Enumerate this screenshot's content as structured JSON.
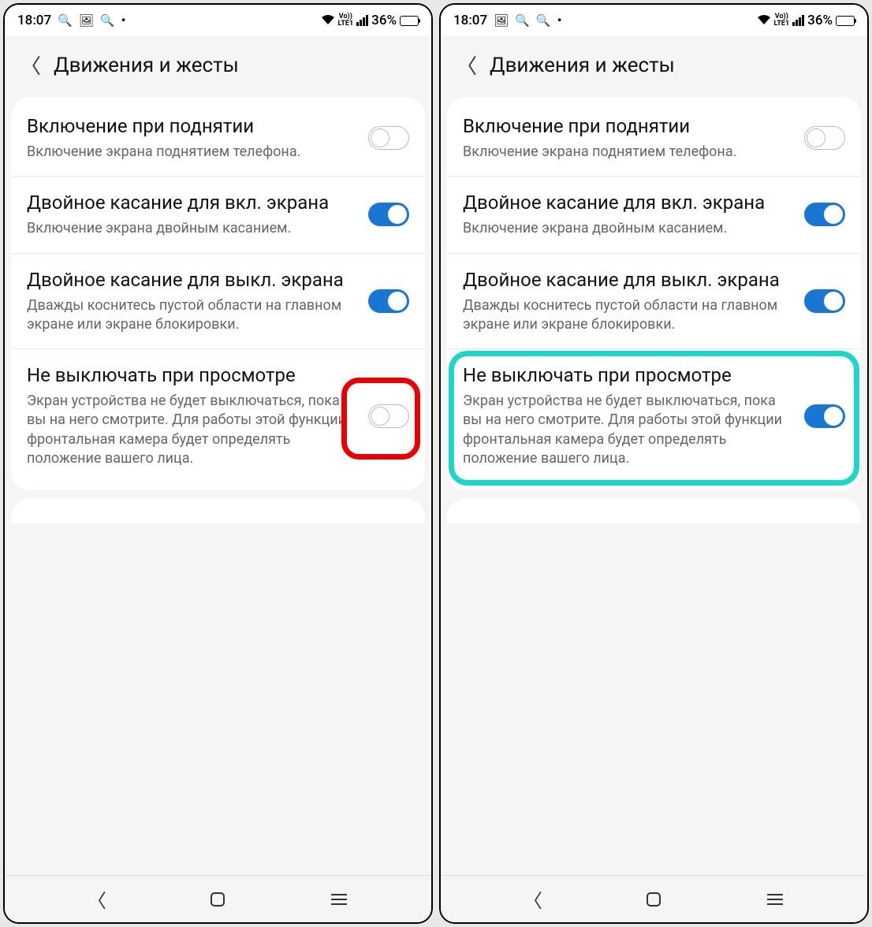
{
  "statusbar": {
    "time": "18:07",
    "battery_pct": "36%"
  },
  "header": {
    "title": "Движения и жесты"
  },
  "settings": [
    {
      "title": "Включение при поднятии",
      "desc": "Включение экрана поднятием телефона.",
      "toggle": "off"
    },
    {
      "title": "Двойное касание для вкл. экрана",
      "desc": "Включение экрана двойным касанием.",
      "toggle": "on"
    },
    {
      "title": "Двойное касание для выкл. экрана",
      "desc": "Дважды коснитесь пустой области на главном экране или экране блокировки.",
      "toggle": "on"
    },
    {
      "title": "Не выключать при просмотре",
      "desc": "Экран устройства не будет выключаться, пока вы на него смотрите. Для работы этой функции фронтальная камера будет определять положение вашего лица.",
      "toggle_left": "off",
      "toggle_right": "on"
    }
  ]
}
